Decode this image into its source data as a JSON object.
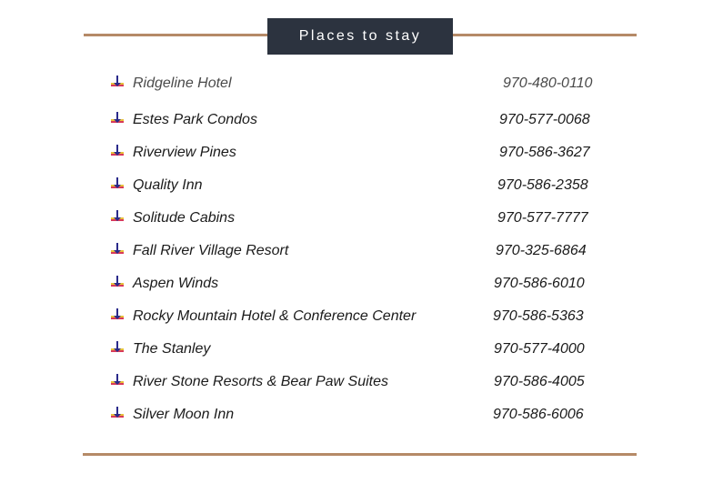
{
  "section": {
    "title": "Places to stay"
  },
  "colors": {
    "rule": "#b58a67",
    "title_bg": "#2c333f",
    "title_text": "#ffffff",
    "bullet_arrow": "#2a2a8a",
    "bullet_bar_top": "#e8c23a",
    "bullet_bar_bottom": "#d83a5a"
  },
  "bullet_icon": "down-arrow-bar-icon",
  "places": [
    {
      "name": "Ridgeline Hotel",
      "phone": "970-480-0110"
    },
    {
      "name": "Estes Park Condos",
      "phone": "970-577-0068"
    },
    {
      "name": "Riverview Pines",
      "phone": "970-586-3627"
    },
    {
      "name": "Quality Inn",
      "phone": "970-586-2358"
    },
    {
      "name": "Solitude Cabins",
      "phone": "970-577-7777"
    },
    {
      "name": "Fall River Village Resort",
      "phone": "970-325-6864"
    },
    {
      "name": "Aspen Winds",
      "phone": "970-586-6010"
    },
    {
      "name": "Rocky Mountain Hotel & Conference Center",
      "phone": "970-586-5363"
    },
    {
      "name": "The Stanley",
      "phone": "970-577-4000"
    },
    {
      "name": "River Stone Resorts & Bear Paw Suites",
      "phone": "970-586-4005"
    },
    {
      "name": "Silver Moon Inn",
      "phone": "970-586-6006"
    }
  ]
}
